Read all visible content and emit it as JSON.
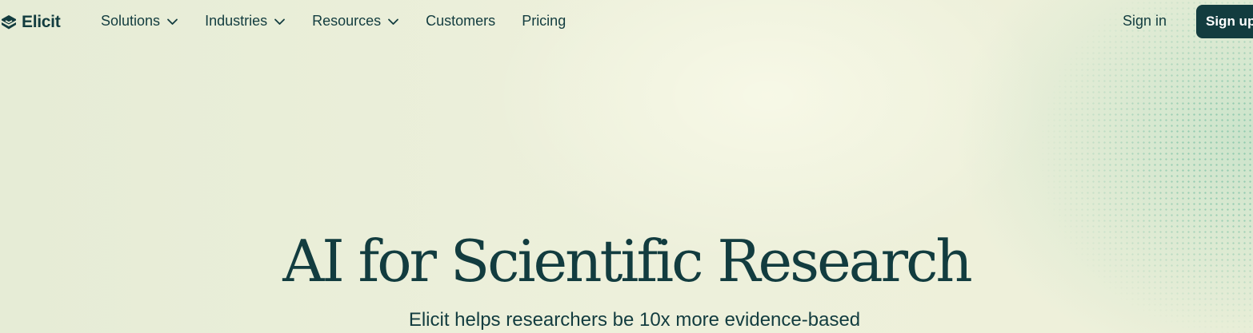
{
  "brand": {
    "name": "Elicit",
    "logo_icon": "elicit-logo-icon",
    "colors": {
      "primary": "#123c3f",
      "background": "#ecefd9",
      "accent_dots": "#46aa8c"
    }
  },
  "nav": {
    "items": [
      {
        "label": "Solutions",
        "has_dropdown": true,
        "icon": "chevron-down-icon"
      },
      {
        "label": "Industries",
        "has_dropdown": true,
        "icon": "chevron-down-icon"
      },
      {
        "label": "Resources",
        "has_dropdown": true,
        "icon": "chevron-down-icon"
      },
      {
        "label": "Customers",
        "has_dropdown": false
      },
      {
        "label": "Pricing",
        "has_dropdown": false
      }
    ],
    "sign_in": "Sign in",
    "sign_up": "Sign up"
  },
  "hero": {
    "title": "AI for Scientific Research",
    "subtitle": "Elicit helps researchers be 10x more evidence-based"
  }
}
